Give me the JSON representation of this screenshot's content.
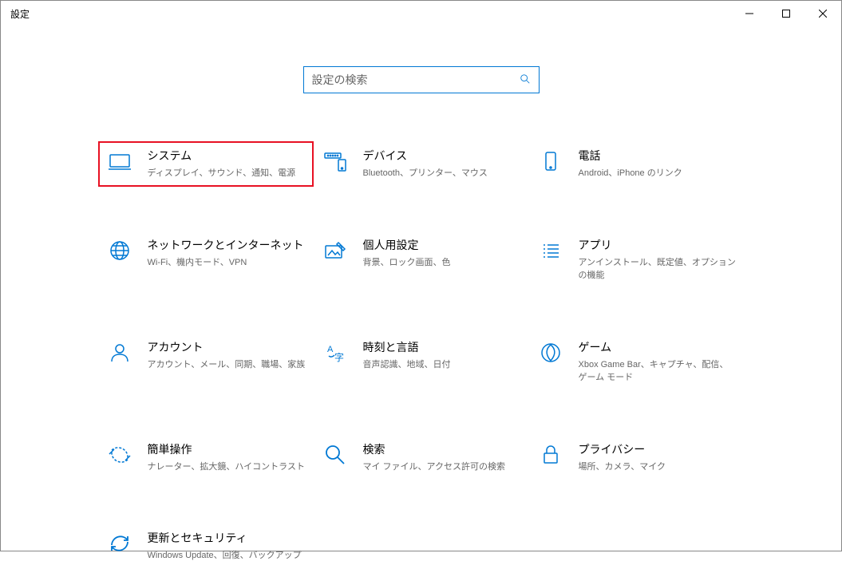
{
  "window": {
    "title": "設定"
  },
  "search": {
    "placeholder": "設定の検索"
  },
  "tiles": [
    {
      "id": "system",
      "title": "システム",
      "desc": "ディスプレイ、サウンド、通知、電源",
      "highlighted": true
    },
    {
      "id": "devices",
      "title": "デバイス",
      "desc": "Bluetooth、プリンター、マウス",
      "highlighted": false
    },
    {
      "id": "phone",
      "title": "電話",
      "desc": "Android、iPhone のリンク",
      "highlighted": false
    },
    {
      "id": "network",
      "title": "ネットワークとインターネット",
      "desc": "Wi-Fi、機内モード、VPN",
      "highlighted": false
    },
    {
      "id": "personalization",
      "title": "個人用設定",
      "desc": "背景、ロック画面、色",
      "highlighted": false
    },
    {
      "id": "apps",
      "title": "アプリ",
      "desc": "アンインストール、既定値、オプションの機能",
      "highlighted": false
    },
    {
      "id": "accounts",
      "title": "アカウント",
      "desc": "アカウント、メール、同期、職場、家族",
      "highlighted": false
    },
    {
      "id": "time",
      "title": "時刻と言語",
      "desc": "音声認識、地域、日付",
      "highlighted": false
    },
    {
      "id": "gaming",
      "title": "ゲーム",
      "desc": "Xbox Game Bar、キャプチャ、配信、ゲーム モード",
      "highlighted": false
    },
    {
      "id": "ease",
      "title": "簡単操作",
      "desc": "ナレーター、拡大鏡、ハイコントラスト",
      "highlighted": false
    },
    {
      "id": "search",
      "title": "検索",
      "desc": "マイ ファイル、アクセス許可の検索",
      "highlighted": false
    },
    {
      "id": "privacy",
      "title": "プライバシー",
      "desc": "場所、カメラ、マイク",
      "highlighted": false
    },
    {
      "id": "update",
      "title": "更新とセキュリティ",
      "desc": "Windows Update、回復、バックアップ",
      "highlighted": false
    }
  ]
}
